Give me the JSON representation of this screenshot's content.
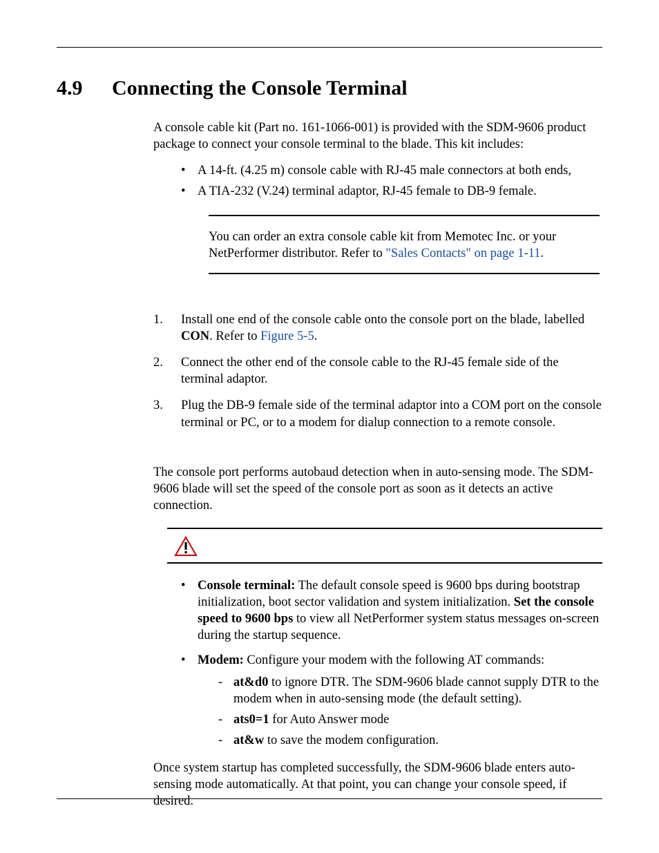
{
  "heading": {
    "number": "4.9",
    "title": "Connecting the Console Terminal"
  },
  "intro1": "A console cable kit (Part no. 161-1066-001) is provided with the SDM-9606 product package to connect your console terminal to the blade. This kit includes:",
  "kit": [
    "A 14-ft. (4.25 m) console cable with RJ-45 male connectors at both ends,",
    "A TIA-232 (V.24) terminal adaptor, RJ-45 female to DB-9 female."
  ],
  "note": {
    "pre": "You can order an extra console cable kit from Memotec Inc. or your NetPerformer distributor. Refer to ",
    "link": "\"Sales Contacts\" on page 1-11",
    "post": "."
  },
  "steps": [
    {
      "pre": "Install one end of the console cable onto the console port on the blade, labelled ",
      "bold": "CON",
      "mid": ". Refer to ",
      "link": "Figure 5-5",
      "post": "."
    },
    {
      "text": "Connect the other end of the console cable to the RJ-45 female side of the terminal adaptor."
    },
    {
      "text": "Plug the DB-9 female side of the terminal adaptor into a COM port on the console terminal or PC, or to a modem for dialup connection to a remote console."
    }
  ],
  "autobaud": "The console port performs autobaud detection when in auto-sensing mode. The SDM-9606 blade will set the speed of the console port as soon as it detects an active connection.",
  "caution": {
    "item1": {
      "bold1": "Console terminal:",
      "t1": " The default console speed is 9600 bps during bootstrap initialization, boot sector validation and system initialization. ",
      "bold2": "Set the console speed to 9600 bps",
      "t2": " to view all NetPerformer system status messages on-screen during the startup sequence."
    },
    "item2": {
      "bold1": "Modem:",
      "t1": " Configure your modem with the following AT commands:"
    },
    "dash1": {
      "bold": "at&d0",
      "text": " to ignore DTR. The SDM-9606 blade cannot supply DTR to the modem when in auto-sensing mode (the default setting)."
    },
    "dash2": {
      "bold": "ats0=1",
      "text": " for Auto Answer mode"
    },
    "dash3": {
      "bold": "at&w",
      "text": " to save the modem configuration."
    }
  },
  "closing": "Once system startup has completed successfully, the SDM-9606 blade enters auto-sensing mode automatically. At that point, you can change your console speed, if desired."
}
